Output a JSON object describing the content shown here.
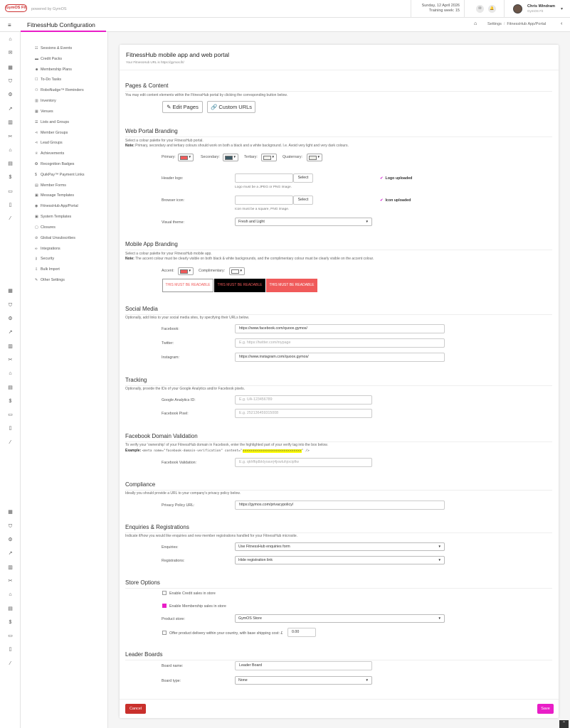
{
  "header": {
    "logo": "GymOS Fit",
    "powered_by": "powered by GymOS",
    "date": "Sunday, 12 April 2026",
    "training_week": "Training week: 15",
    "user_name": "Chris Windram",
    "user_sub": "GymOS Fit"
  },
  "nav": {
    "page_title": "FitnessHub Configuration",
    "breadcrumb": [
      "Settings",
      "FitnessHub App/Portal"
    ]
  },
  "sidebar": {
    "items": [
      "Sessions & Events",
      "Credit Packs",
      "Membership Plans",
      "To-Do Tasks",
      "RoboNudge™ Reminders",
      "Inventory",
      "Venues",
      "Lists and Groups",
      "Member Groups",
      "Lead Groups",
      "Achievements",
      "Recognition Badges",
      "QuikPay™ Payment Links",
      "Member Forms",
      "Message Templates",
      "FitnessHub App/Portal",
      "System Templates",
      "Closures",
      "Global Unsubscribes",
      "Integrations",
      "Security",
      "Bulk Import",
      "Other Settings"
    ]
  },
  "card": {
    "title": "FitnessHub mobile app and web portal",
    "url_note": "Your FitnessHub URL is https://gymos.fit/"
  },
  "pages": {
    "heading": "Pages & Content",
    "desc": "You may edit content elements within the FitnessHub portal by clicking the corresponding button below.",
    "edit_pages": "Edit Pages",
    "custom_urls": "Custom URLs"
  },
  "branding": {
    "heading": "Web Portal Branding",
    "desc": "Select a colour palette for your FitnessHub portal.",
    "note_label": "Note:",
    "note": "Primary, secondary and tertiary colours should work on both a black and a white background. I.e. Avoid very light and very dark colours.",
    "primary": "Primary:",
    "secondary": "Secondary:",
    "tertiary": "Tertiary:",
    "quaternary": "Quaternary:",
    "header_logo": "Header logo:",
    "select": "Select",
    "logo_uploaded": "Logo uploaded",
    "logo_help": "Logo must be a JPEG or PNG image.",
    "browser_icon": "Browser icon:",
    "icon_uploaded": "Icon uploaded",
    "icon_help": "Icon must be a square, PNG image.",
    "visual_theme": "Visual theme:",
    "visual_theme_value": "Fresh and Light",
    "colors": {
      "primary": "#f05a5a",
      "secondary": "#3d5a66",
      "tertiary": "#f2f2ee",
      "quaternary": "#ebebe6"
    }
  },
  "mobile": {
    "heading": "Mobile App Branding",
    "desc": "Select a colour palette for your FitnessHub mobile app.",
    "note_label": "Note:",
    "note": "The accent colour must be clearly visible on both black & white backgrounds, and the complimentary colour must be clearly visible on the accent colour.",
    "accent": "Accent:",
    "complimentary": "Complimentary:",
    "readable": "THIS MUST BE READABLE",
    "colors": {
      "accent": "#f05a5a",
      "complimentary": "#ffffff"
    }
  },
  "social": {
    "heading": "Social Media",
    "desc": "Optionally, add links to your social media sites, by specifying their URLs below.",
    "facebook_label": "Facebook:",
    "facebook_value": "https://www.facebook.com/quoox.gymos/",
    "twitter_label": "Twitter:",
    "twitter_placeholder": "E.g. https://twitter.com/mypage",
    "instagram_label": "Instagram:",
    "instagram_value": "https://www.instagram.com/quoox.gymos/"
  },
  "tracking": {
    "heading": "Tracking",
    "desc": "Optionally, provide the IDs of your Google Analytics and/or Facebook pixels.",
    "ga_label": "Google Analytics ID:",
    "ga_placeholder": "E.g. UA-123456789",
    "fb_label": "Facebook Pixel:",
    "fb_placeholder": "E.g. 252136459315008"
  },
  "fbdomain": {
    "heading": "Facebook Domain Validation",
    "desc": "To verify your 'ownership' of your FitnessHub domain in Facebook, enter the highlighted part of your verify tag into the box below.",
    "example_label": "Example:",
    "code_pre": "<meta name=\"facebook-domain-verification\" content=\"",
    "code_hl": "xxxxxxxxxxxxxxxxxxxxxxxxxxxxxx",
    "code_post": "\" />",
    "label": "Facebook Validation:",
    "placeholder": "E.g. qkhffqdbklyoavrj4jxwluhjocipfiw"
  },
  "compliance": {
    "heading": "Compliance",
    "desc": "Ideally you should provide a URL to your company's privacy policy below.",
    "label": "Privacy Policy URL:",
    "value": "https://gymos.com/privacypolicy/"
  },
  "enquiries": {
    "heading": "Enquiries & Registrations",
    "desc": "Indicate if/how you would like enquiries and new member registrations handled for your FitnessHub microsite.",
    "enq_label": "Enquiries:",
    "enq_value": "Use FitnessHub enquiries form",
    "reg_label": "Registrations:",
    "reg_value": "Hide registration link"
  },
  "store": {
    "heading": "Store Options",
    "credit": "Enable Credit sales in store",
    "membership": "Enable Membership sales in store",
    "product_label": "Product store:",
    "product_value": "GymOS Store",
    "delivery": "Offer product delivery within your country, with base shipping cost: £",
    "shipping": "0.00"
  },
  "leader": {
    "heading": "Leader Boards",
    "name_label": "Board name:",
    "name_value": "Leader Board",
    "type_label": "Board type:",
    "type_value": "None"
  },
  "footer": {
    "cancel": "Cancel",
    "save": "Save"
  },
  "accent_color": "#e91ec7"
}
